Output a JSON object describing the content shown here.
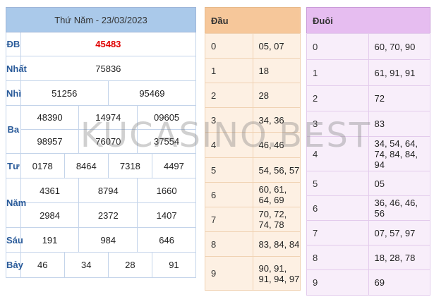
{
  "main": {
    "title": "Thứ Năm - 23/03/2023",
    "rows": [
      {
        "label": "ĐB",
        "values": [
          "45483"
        ]
      },
      {
        "label": "Nhất",
        "values": [
          "75836"
        ]
      },
      {
        "label": "Nhì",
        "values": [
          "51256",
          "95469"
        ]
      },
      {
        "label": "Ba",
        "values": [
          "48390",
          "14974",
          "09605",
          "98957",
          "76070",
          "37554"
        ]
      },
      {
        "label": "Tư",
        "values": [
          "0178",
          "8464",
          "7318",
          "4497"
        ]
      },
      {
        "label": "Năm",
        "values": [
          "4361",
          "8794",
          "1660",
          "2984",
          "2372",
          "1407"
        ]
      },
      {
        "label": "Sáu",
        "values": [
          "191",
          "984",
          "646"
        ]
      },
      {
        "label": "Bảy",
        "values": [
          "46",
          "34",
          "28",
          "91"
        ]
      }
    ]
  },
  "dau": {
    "header": "Đầu",
    "rows": [
      {
        "key": "0",
        "value": "05, 07"
      },
      {
        "key": "1",
        "value": "18"
      },
      {
        "key": "2",
        "value": "28"
      },
      {
        "key": "3",
        "value": "34, 36"
      },
      {
        "key": "4",
        "value": "46, 46"
      },
      {
        "key": "5",
        "value": "54, 56, 57"
      },
      {
        "key": "6",
        "value": "60, 61, 64, 69"
      },
      {
        "key": "7",
        "value": "70, 72, 74, 78"
      },
      {
        "key": "8",
        "value": "83, 84, 84"
      },
      {
        "key": "9",
        "value": "90, 91, 91, 94, 97"
      }
    ]
  },
  "duoi": {
    "header": "Đuôi",
    "rows": [
      {
        "key": "0",
        "value": "60, 70, 90"
      },
      {
        "key": "1",
        "value": "61, 91, 91"
      },
      {
        "key": "2",
        "value": "72"
      },
      {
        "key": "3",
        "value": "83"
      },
      {
        "key": "4",
        "value": "34, 54, 64, 74, 84, 84, 94"
      },
      {
        "key": "5",
        "value": "05"
      },
      {
        "key": "6",
        "value": "36, 46, 46, 56"
      },
      {
        "key": "7",
        "value": "07, 57, 97"
      },
      {
        "key": "8",
        "value": "18, 28, 78"
      },
      {
        "key": "9",
        "value": "69"
      }
    ]
  },
  "watermark": "KUCASINO.BEST"
}
